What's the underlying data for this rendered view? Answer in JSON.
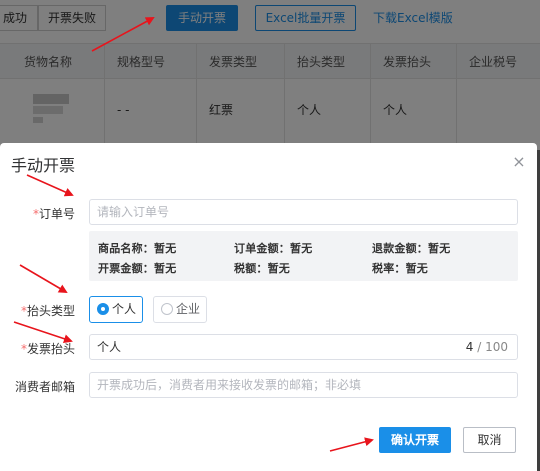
{
  "toolbar": {
    "tab_success": "成功",
    "tab_failed": "开票失败",
    "manual_invoice": "手动开票",
    "excel_batch": "Excel批量开票",
    "download_template": "下载Excel模版"
  },
  "table": {
    "columns": [
      "货物名称",
      "规格型号",
      "发票类型",
      "抬头类型",
      "发票抬头",
      "企业税号"
    ],
    "row": {
      "spec": "- -",
      "invoice_type": "红票",
      "title_type": "个人",
      "invoice_title": "个人"
    }
  },
  "dialog": {
    "title": "手动开票",
    "close": "×",
    "order_label": "订单号",
    "order_placeholder": "请输入订单号",
    "info": {
      "product": "商品名称：暂无",
      "order_amount": "订单金额：暂无",
      "refund_amount": "退款金额：暂无",
      "invoice_amount": "开票金额：暂无",
      "tax": "税额：暂无",
      "tax_rate": "税率：暂无"
    },
    "title_type_label": "抬头类型",
    "title_type_options": [
      "个人",
      "企业"
    ],
    "title_type_selected": "个人",
    "invoice_title_label": "发票抬头",
    "invoice_title_value": "个人",
    "invoice_title_count": "4",
    "invoice_title_max": "/ 100",
    "email_label": "消费者邮箱",
    "email_placeholder": "开票成功后，消费者用来接收发票的邮箱；非必填",
    "confirm": "确认开票",
    "cancel": "取消"
  },
  "colors": {
    "primary": "#1a8fe8",
    "required": "#f56c6c",
    "annotation_arrow": "#e8141c"
  }
}
